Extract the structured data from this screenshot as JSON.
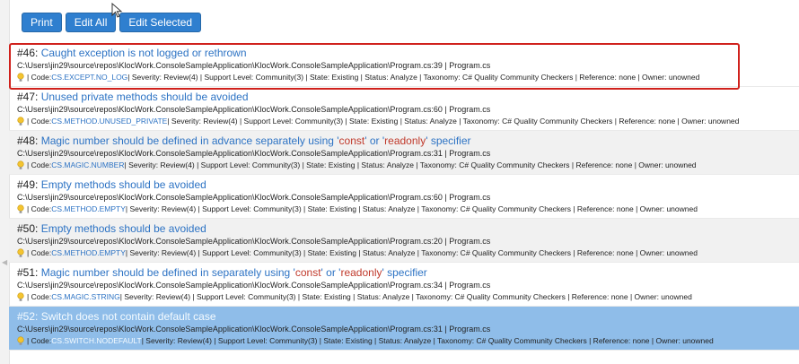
{
  "toolbar": {
    "print_label": "Print",
    "edit_all_label": "Edit All",
    "edit_selected_label": "Edit Selected"
  },
  "issues": [
    {
      "num": "#46:",
      "title": "Caught exception is not logged or rethrown",
      "path": "C:\\Users\\jin29\\source\\repos\\KlocWork.ConsoleSampleApplication\\KlocWork.ConsoleSampleApplication\\Program.cs:39 | Program.cs",
      "code_prefix": "| Code: ",
      "code": "CS.EXCEPT.NO_LOG",
      "details": "| Severity: Review(4) | Support Level: Community(3) | State: Existing | Status: Analyze | Taxonomy: C# Quality Community Checkers | Reference: none | Owner: unowned"
    },
    {
      "num": "#47:",
      "title": "Unused private methods should be avoided",
      "path": "C:\\Users\\jin29\\source\\repos\\KlocWork.ConsoleSampleApplication\\KlocWork.ConsoleSampleApplication\\Program.cs:60 | Program.cs",
      "code_prefix": "| Code: ",
      "code": "CS.METHOD.UNUSED_PRIVATE",
      "details": "| Severity: Review(4) | Support Level: Community(3) | State: Existing | Status: Analyze | Taxonomy: C# Quality Community Checkers | Reference: none | Owner: unowned"
    },
    {
      "num": "#48:",
      "title_a": "Magic number should be defined in advance separately using '",
      "title_kw1": "const",
      "title_b": "' or '",
      "title_kw2": "readonly",
      "title_c": "' specifier",
      "path": "C:\\Users\\jin29\\source\\repos\\KlocWork.ConsoleSampleApplication\\KlocWork.ConsoleSampleApplication\\Program.cs:31 | Program.cs",
      "code_prefix": "| Code: ",
      "code": "CS.MAGIC.NUMBER",
      "details": "| Severity: Review(4) | Support Level: Community(3) | State: Existing | Status: Analyze | Taxonomy: C# Quality Community Checkers | Reference: none | Owner: unowned"
    },
    {
      "num": "#49:",
      "title": "Empty methods should be avoided",
      "path": "C:\\Users\\jin29\\source\\repos\\KlocWork.ConsoleSampleApplication\\KlocWork.ConsoleSampleApplication\\Program.cs:60 | Program.cs",
      "code_prefix": "| Code: ",
      "code": "CS.METHOD.EMPTY",
      "details": "| Severity: Review(4) | Support Level: Community(3) | State: Existing | Status: Analyze | Taxonomy: C# Quality Community Checkers | Reference: none | Owner: unowned"
    },
    {
      "num": "#50:",
      "title": "Empty methods should be avoided",
      "path": "C:\\Users\\jin29\\source\\repos\\KlocWork.ConsoleSampleApplication\\KlocWork.ConsoleSampleApplication\\Program.cs:20 | Program.cs",
      "code_prefix": "| Code: ",
      "code": "CS.METHOD.EMPTY",
      "details": "| Severity: Review(4) | Support Level: Community(3) | State: Existing | Status: Analyze | Taxonomy: C# Quality Community Checkers | Reference: none | Owner: unowned"
    },
    {
      "num": "#51:",
      "title_a": "Magic number should be defined in separately using '",
      "title_kw1": "const",
      "title_b": "' or '",
      "title_kw2": "readonly",
      "title_c": "' specifier",
      "path": "C:\\Users\\jin29\\source\\repos\\KlocWork.ConsoleSampleApplication\\KlocWork.ConsoleSampleApplication\\Program.cs:34 | Program.cs",
      "code_prefix": "| Code: ",
      "code": "CS.MAGIC.STRING",
      "details": "| Severity: Review(4) | Support Level: Community(3) | State: Existing | Status: Analyze | Taxonomy: C# Quality Community Checkers | Reference: none | Owner: unowned"
    },
    {
      "num": "#52:",
      "title": "Switch does not contain default case",
      "path": "C:\\Users\\jin29\\source\\repos\\KlocWork.ConsoleSampleApplication\\KlocWork.ConsoleSampleApplication\\Program.cs:31 | Program.cs",
      "code_prefix": "| Code: ",
      "code": "CS.SWITCH.NODEFAULT",
      "details": "| Severity: Review(4) | Support Level: Community(3) | State: Existing | Status: Analyze | Taxonomy: C# Quality Community Checkers | Reference: none | Owner: unowned"
    }
  ],
  "icons": {
    "bulb": "lightbulb-icon",
    "cursor": "mouse-cursor-icon",
    "rail": "chevron-left-icon"
  },
  "colors": {
    "button_bg": "#2f7fcf",
    "link": "#2d73c4",
    "keyword": "#c0392b",
    "selected_row": "#8fbde9",
    "alt_row": "#f1f1f1",
    "highlight_box": "#d0211c"
  },
  "selected_issue": "#52:",
  "highlighted_issue": "#46:"
}
